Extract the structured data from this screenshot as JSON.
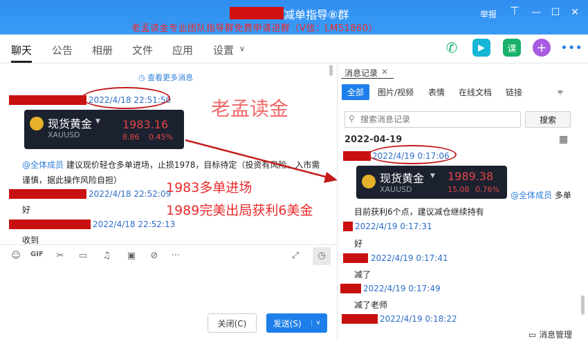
{
  "window": {
    "title": "减单指导⑧群",
    "promo": "老孟读金专业团队指导群免费申请进群（V信：LM51860）",
    "report": "举报"
  },
  "tabs": [
    "聊天",
    "公告",
    "相册",
    "文件",
    "应用",
    "设置"
  ],
  "overlay": {
    "watermark": "老孟读金",
    "line1": "1983多单进场",
    "line2": "1989完美出局获利6美金"
  },
  "chat": {
    "view_more": "查看更多消息",
    "messages": [
      {
        "time": "2022/4/18 22:51:50"
      },
      {
        "mention": "@全体成员",
        "text": "建议现价轻仓多单进场，止损1978，目标待定（投资有风险，入市需谨慎，据此操作风险自担）"
      },
      {
        "time": "2022/4/18 22:52:09",
        "text": "好"
      },
      {
        "time": "2022/4/18 22:52:13",
        "text": "收到"
      }
    ],
    "card": {
      "name": "现货黄金",
      "symbol": "XAUUSD",
      "price": "1983.16",
      "change": "8.86",
      "percent": "0.45%"
    }
  },
  "buttons": {
    "close": "关闭(C)",
    "send": "发送(S)"
  },
  "history": {
    "tab": "消息记录",
    "filters": [
      "全部",
      "图片/视频",
      "表情",
      "在线文档",
      "链接"
    ],
    "search_placeholder": "搜索消息记录",
    "search_btn": "搜索",
    "date": "2022-04-19",
    "card": {
      "name": "现货黄金",
      "symbol": "XAUUSD",
      "price": "1989.38",
      "change": "15.08",
      "percent": "0.76%"
    },
    "entries": [
      {
        "time": "2022/4/19 0:17:06",
        "mention": "@全体成员",
        "tail": "多单",
        "text": "目前获利6个点，建议减仓继续持有"
      },
      {
        "time": "2022/4/19 0:17:31",
        "text": "好"
      },
      {
        "time": "2022/4/19 0:17:41",
        "text": "减了"
      },
      {
        "time": "2022/4/19 0:17:49",
        "text": "减了老师"
      },
      {
        "time": "2022/4/19 0:18:22",
        "text": ""
      }
    ],
    "manage": "消息管理"
  },
  "colors": {
    "titlebar": "#3a9bf5",
    "accent": "#1e7fea",
    "redact": "#c91010",
    "annotation": "#ea2a2a"
  }
}
